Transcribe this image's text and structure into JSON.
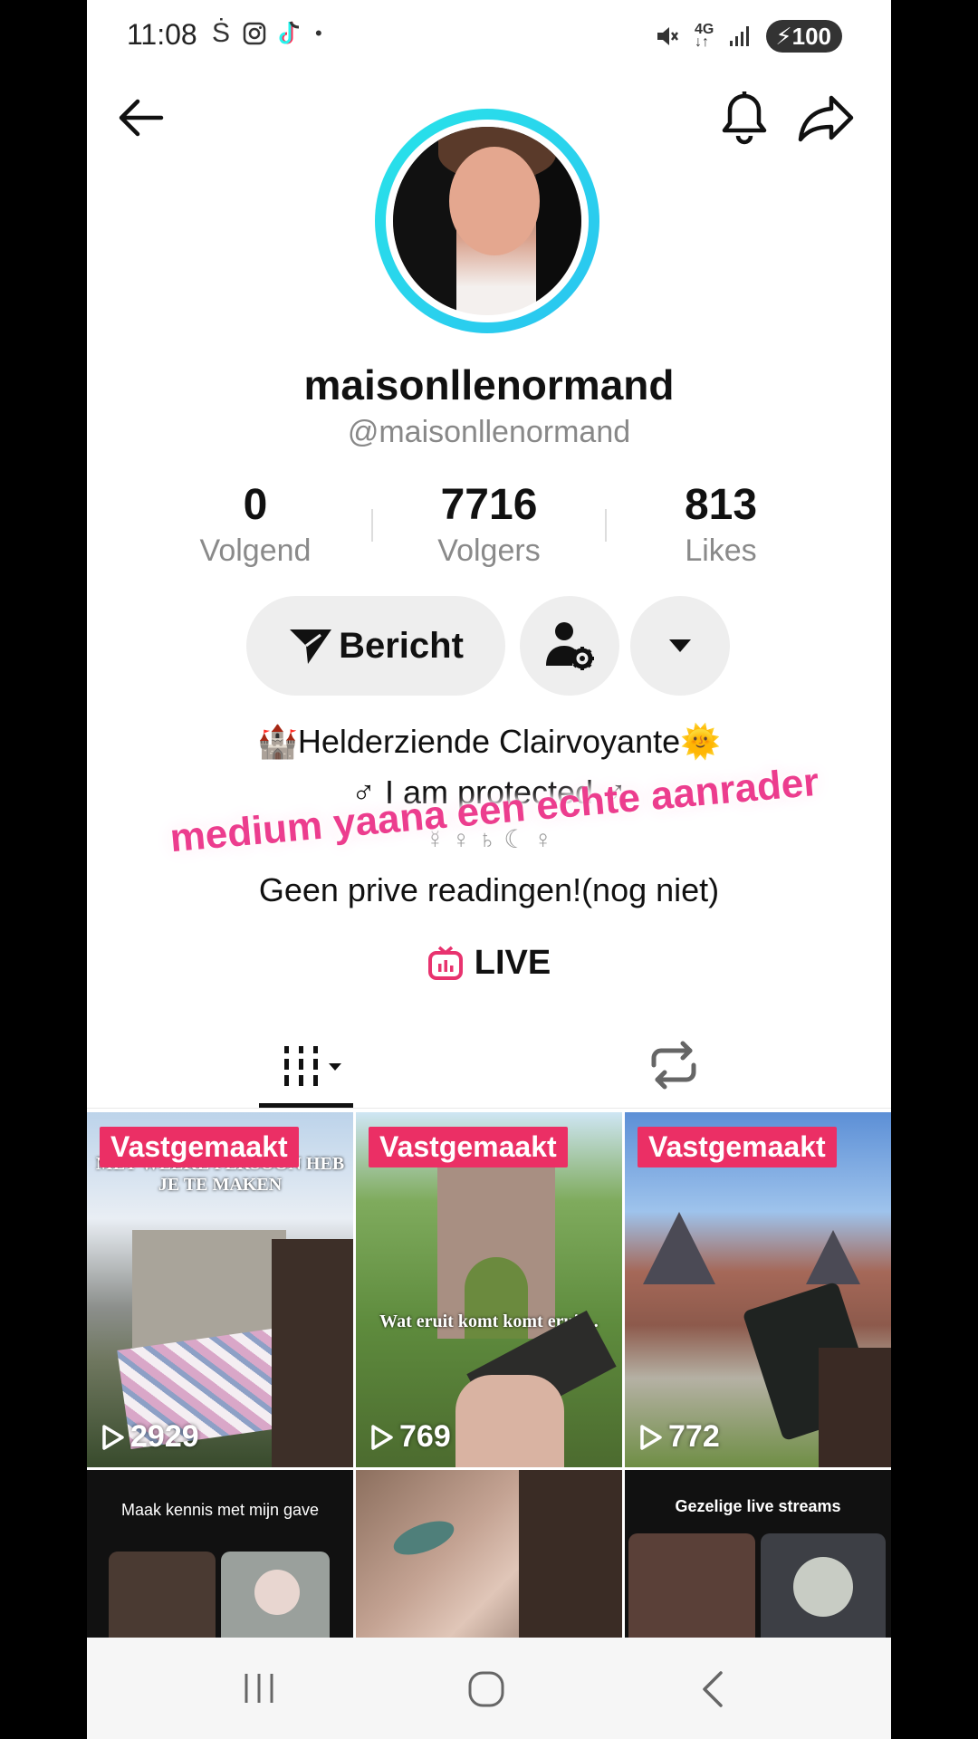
{
  "status_bar": {
    "time": "11:08",
    "battery": "100",
    "network": "4G"
  },
  "profile": {
    "display_name": "maisonllenormand",
    "handle": "@maisonllenormand",
    "stats": [
      {
        "value": "0",
        "label": "Volgend"
      },
      {
        "value": "7716",
        "label": "Volgers"
      },
      {
        "value": "813",
        "label": "Likes"
      }
    ],
    "message_button": "Bericht",
    "bio": {
      "line1": "🏰Helderziende Clairvoyante🌞",
      "line2": "♂ I am protected ♂",
      "line3": "☿ ♀ ♄ ☾ ♀",
      "line4": "Geen prive readingen!(nog niet)"
    },
    "overlay_text": "medium yaana een echte aanrader",
    "live_label": "LIVE"
  },
  "videos": [
    {
      "pinned": "Vastgemaakt",
      "views": "2929",
      "caption": "MET WELKE PERSOON HEB JE TE MAKEN"
    },
    {
      "pinned": "Vastgemaakt",
      "views": "769",
      "caption": "Wat eruit komt komt eruit..."
    },
    {
      "pinned": "Vastgemaakt",
      "views": "772",
      "caption": ""
    },
    {
      "caption": "Maak kennis met mijn gave"
    },
    {
      "caption": ""
    },
    {
      "caption": "Gezelige live streams"
    }
  ],
  "colors": {
    "accent": "#eb2f65",
    "ring": "#28e3e9",
    "live": "#e8336f"
  }
}
